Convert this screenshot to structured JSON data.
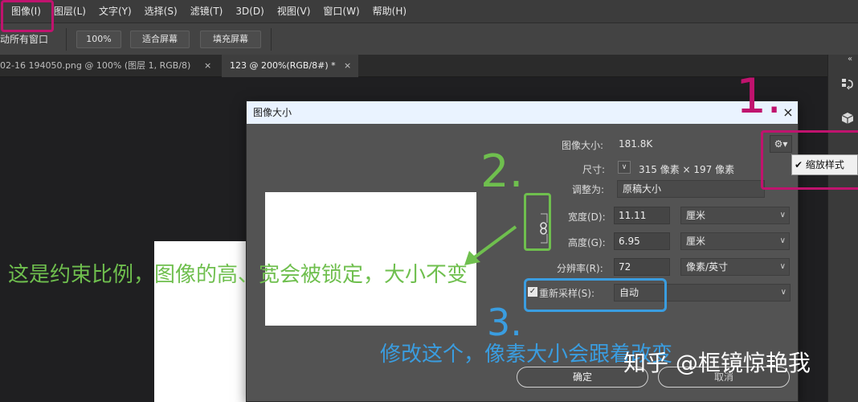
{
  "menu": {
    "items": [
      "图像(I)",
      "图层(L)",
      "文字(Y)",
      "选择(S)",
      "滤镜(T)",
      "3D(D)",
      "视图(V)",
      "窗口(W)",
      "帮助(H)"
    ]
  },
  "options": {
    "scroll_all_windows": "动所有窗口",
    "zoom_100": "100%",
    "fit_screen": "适合屏幕",
    "fill_screen": "填充屏幕"
  },
  "tabs": [
    {
      "label": "02-16 194050.png @ 100% (图层 1, RGB/8)",
      "close": "×"
    },
    {
      "label": "123 @ 200%(RGB/8#) *",
      "close": "×"
    }
  ],
  "dock": {
    "top_arrows": "«",
    "icon1": "history-icon",
    "icon2": "3d-cube-icon"
  },
  "dialog": {
    "title": "图像大小",
    "close": "×",
    "image_size_label": "图像大小:",
    "image_size_value": "181.8K",
    "dimensions_label": "尺寸:",
    "dimensions_value": "315 像素  ×  197 像素",
    "fit_to_label": "调整为:",
    "fit_to_value": "原稿大小",
    "width_label": "宽度(D):",
    "width_value": "11.11",
    "width_unit": "厘米",
    "height_label": "高度(G):",
    "height_value": "6.95",
    "height_unit": "厘米",
    "resolution_label": "分辨率(R):",
    "resolution_value": "72",
    "resolution_unit": "像素/英寸",
    "resample_label": "重新采样(S):",
    "resample_value": "自动",
    "ok": "确定",
    "cancel": "取消",
    "gear": "⚙▾",
    "popup_check": "✔",
    "popup_label": "缩放样式"
  },
  "annotations": {
    "num1": "1.",
    "num2": "2.",
    "num3": "3.",
    "text_green": "这是约束比例，图像的高、宽会被锁定，大小不变",
    "text_blue": "修改这个，像素大小会跟着改变",
    "colors": {
      "magenta": "#c0136e",
      "green": "#6fbf4e",
      "blue": "#3a9de0"
    }
  },
  "watermark": "知乎 @框镜惊艳我"
}
